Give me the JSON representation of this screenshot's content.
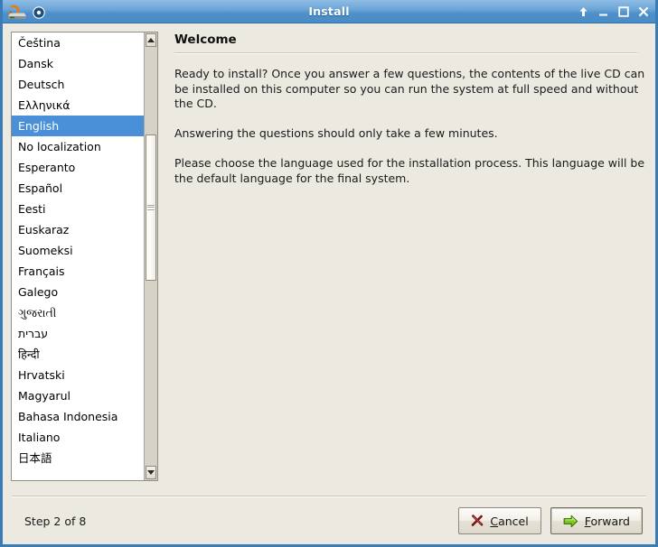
{
  "window": {
    "title": "Install",
    "icons": {
      "app": "cd-drive-icon",
      "disc": "optical-disc-icon"
    },
    "controls": [
      {
        "name": "shade-button",
        "glyph": "shade-up-icon"
      },
      {
        "name": "minimize-button",
        "glyph": "minimize-icon"
      },
      {
        "name": "maximize-button",
        "glyph": "maximize-icon"
      },
      {
        "name": "close-button",
        "glyph": "close-icon"
      }
    ]
  },
  "language_list": {
    "selected": "English",
    "items": [
      "Čeština",
      "Dansk",
      "Deutsch",
      "Ελληνικά",
      "English",
      "No localization",
      "Esperanto",
      "Español",
      "Eesti",
      "Euskaraz",
      "Suomeksi",
      "Français",
      "Galego",
      "ગુજરાતી",
      "עברית",
      "हिन्दी",
      "Hrvatski",
      "Magyarul",
      "Bahasa Indonesia",
      "Italiano",
      "日本語"
    ],
    "scrollbar": {
      "up_arrow": "scroll-up-icon",
      "down_arrow": "scroll-down-icon"
    }
  },
  "main": {
    "heading": "Welcome",
    "paragraphs": [
      "Ready to install? Once you answer a few questions, the contents of the live CD can be installed on this computer so you can run the system at full speed and without the CD.",
      "Answering the questions should only take a few minutes.",
      "Please choose the language used for the installation process. This language will be the default language for the final system."
    ]
  },
  "footer": {
    "step": "Step 2 of 8",
    "cancel": {
      "label": "Cancel",
      "mnemonic": "C",
      "icon": "cancel-x-icon"
    },
    "forward": {
      "label": "Forward",
      "mnemonic": "F",
      "icon": "arrow-right-icon"
    }
  },
  "colors": {
    "titlebar_blue": "#6ba5d7",
    "selection_blue": "#4a90d9",
    "window_bg": "#ece9e1",
    "border_blue": "#3a7cb5",
    "cancel_red": "#8c1b1b",
    "forward_green": "#73c41d"
  }
}
